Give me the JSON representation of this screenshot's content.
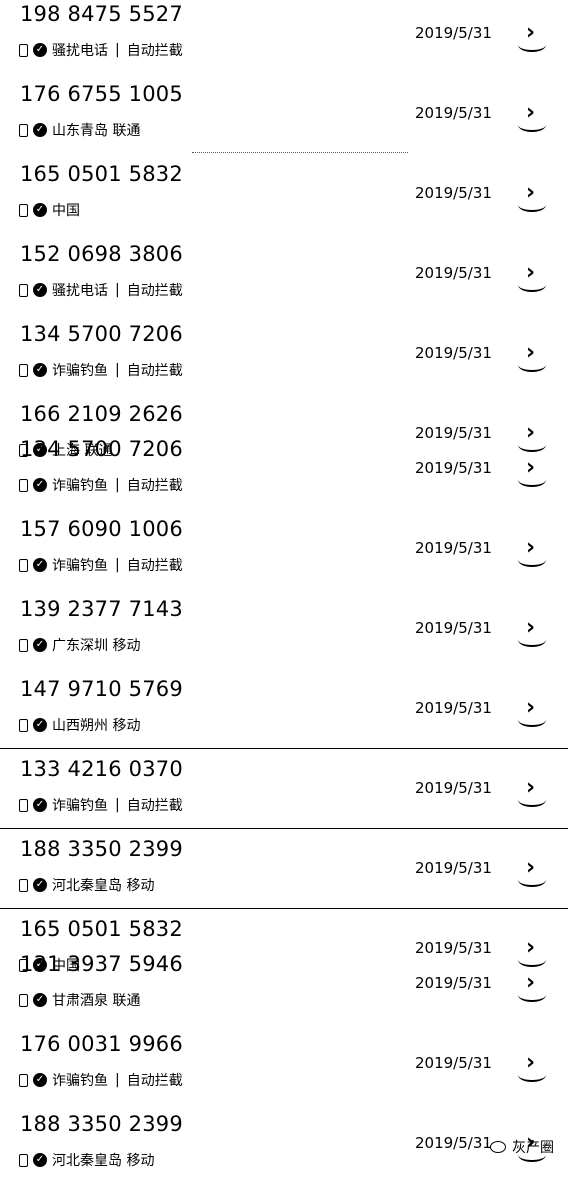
{
  "rows": [
    {
      "number": "198 8475 5527",
      "tag": "骚扰电话",
      "sep": "|",
      "extra": "自动拦截",
      "date": "2019/5/31"
    },
    {
      "number": "176 6755 1005",
      "tag": "山东青岛 联通",
      "sep": "",
      "extra": "",
      "date": "2019/5/31"
    },
    {
      "number": "165 0501 5832",
      "tag": "中国",
      "sep": "",
      "extra": "",
      "date": "2019/5/31"
    },
    {
      "number": "152 0698 3806",
      "tag": "骚扰电话",
      "sep": "|",
      "extra": "自动拦截",
      "date": "2019/5/31"
    },
    {
      "number": "134 5700 7206",
      "tag": "诈骗钓鱼",
      "sep": "|",
      "extra": "自动拦截",
      "date": "2019/5/31"
    },
    {
      "number": "166 2109 2626",
      "tag": "上海 联通",
      "sep": "",
      "extra": "",
      "date": "2019/5/31"
    },
    {
      "number": "134 5700 7206",
      "tag": "诈骗钓鱼",
      "sep": "|",
      "extra": "自动拦截",
      "date": "2019/5/31"
    },
    {
      "number": "157 6090 1006",
      "tag": "诈骗钓鱼",
      "sep": "|",
      "extra": "自动拦截",
      "date": "2019/5/31"
    },
    {
      "number": "139 2377 7143",
      "tag": "广东深圳 移动",
      "sep": "",
      "extra": "",
      "date": "2019/5/31"
    },
    {
      "number": "147 9710 5769",
      "tag": "山西朔州 移动",
      "sep": "",
      "extra": "",
      "date": "2019/5/31"
    },
    {
      "number": "133 4216 0370",
      "tag": "诈骗钓鱼",
      "sep": "|",
      "extra": "自动拦截",
      "date": "2019/5/31"
    },
    {
      "number": "188 3350 2399",
      "tag": "河北秦皇岛 移动",
      "sep": "",
      "extra": "",
      "date": "2019/5/31"
    },
    {
      "number": "165 0501 5832",
      "tag": "中国",
      "sep": "",
      "extra": "",
      "date": "2019/5/31"
    },
    {
      "number": "131 3937 5946",
      "tag": "甘肃酒泉 联通",
      "sep": "",
      "extra": "",
      "date": "2019/5/31"
    },
    {
      "number": "176 0031 9966",
      "tag": "诈骗钓鱼",
      "sep": "|",
      "extra": "自动拦截",
      "date": "2019/5/31"
    },
    {
      "number": "188 3350 2399",
      "tag": "河北秦皇岛 移动",
      "sep": "",
      "extra": "",
      "date": "2019/5/31"
    }
  ],
  "icons": {
    "phone": "phone-icon",
    "check": "blocked-check-icon",
    "info": "chevron-right-icon"
  },
  "watermark": {
    "text": "灰产圈"
  }
}
